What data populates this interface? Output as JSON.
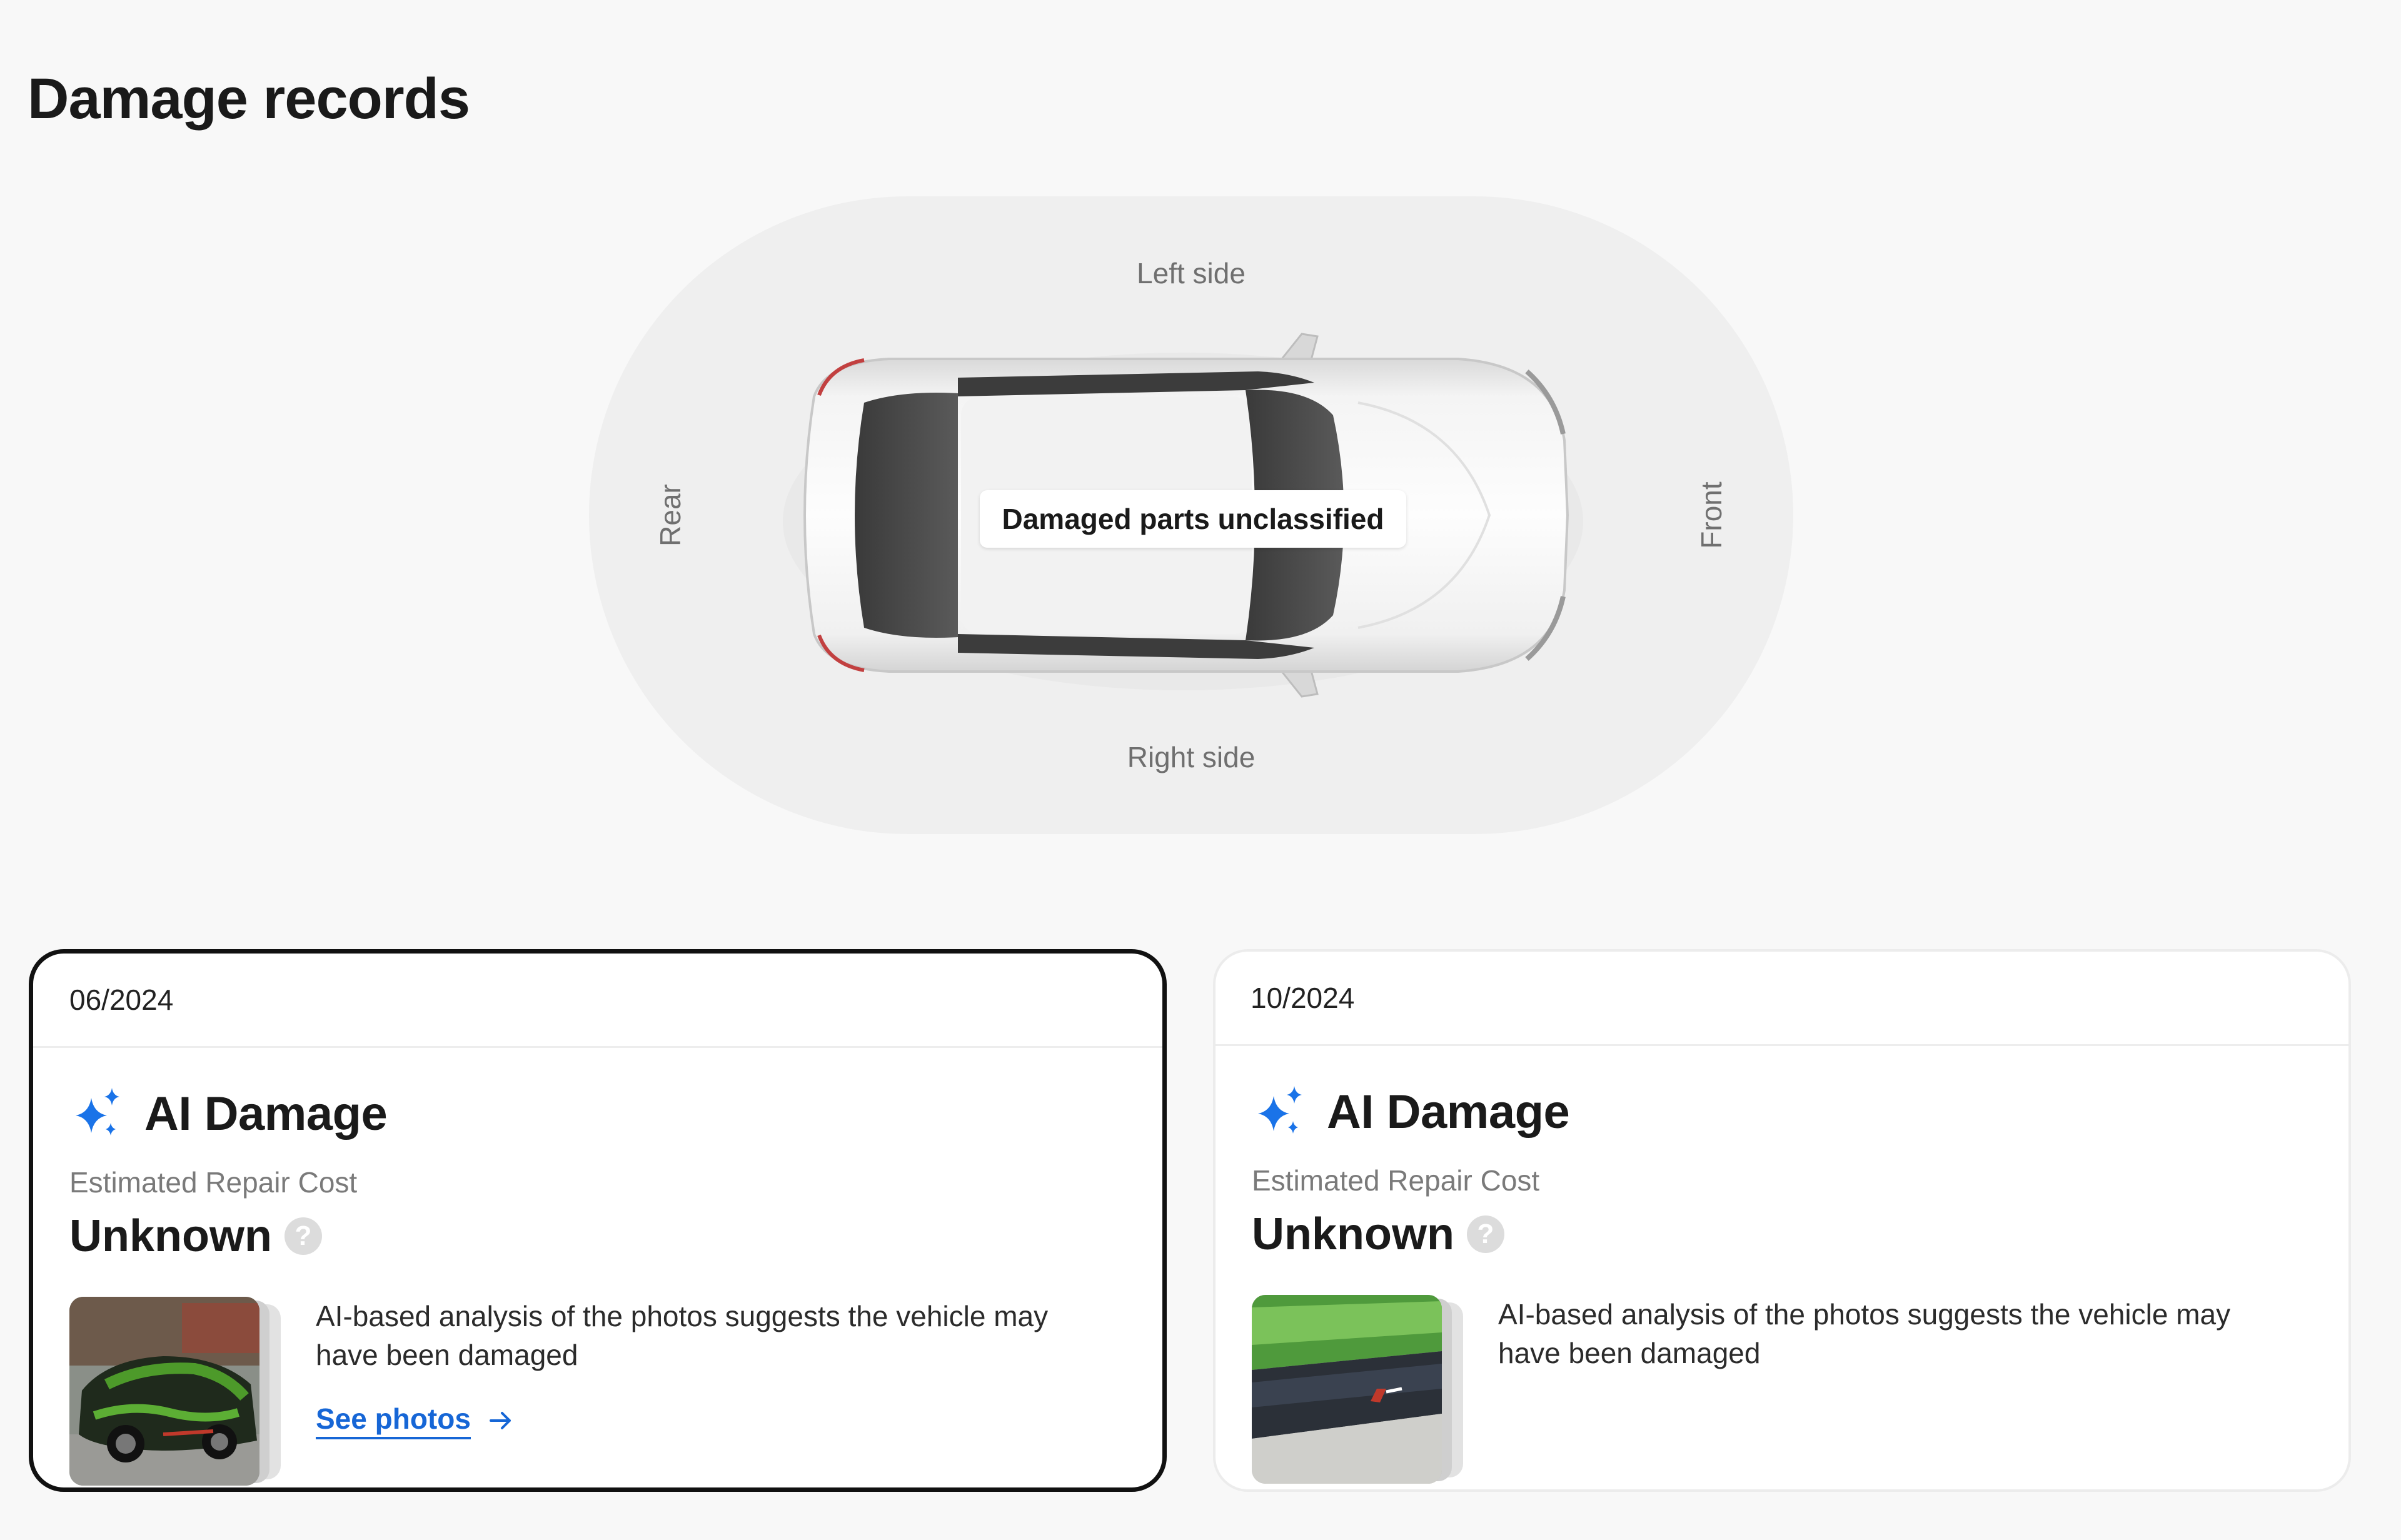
{
  "page": {
    "title": "Damage records"
  },
  "diagram": {
    "left_side": "Left side",
    "right_side": "Right side",
    "rear": "Rear",
    "front": "Front",
    "tag": "Damaged parts unclassified"
  },
  "records": [
    {
      "date": "06/2024",
      "type_title": "AI Damage",
      "cost_label": "Estimated Repair Cost",
      "cost_value": "Unknown",
      "help_glyph": "?",
      "description": "AI-based analysis of the photos suggests the vehicle may have been damaged",
      "link_label": "See photos",
      "selected": true
    },
    {
      "date": "10/2024",
      "type_title": "AI Damage",
      "cost_label": "Estimated Repair Cost",
      "cost_value": "Unknown",
      "help_glyph": "?",
      "description": "AI-based analysis of the photos suggests the vehicle may have been damaged",
      "selected": false
    }
  ],
  "icons": {
    "ai": "sparkles-icon",
    "help": "question-icon",
    "arrow": "arrow-right-icon"
  },
  "colors": {
    "accent": "#1666d6",
    "ai_icon": "#1a73e8",
    "selected_border": "#111111",
    "page_background": "#f8f8f8"
  }
}
